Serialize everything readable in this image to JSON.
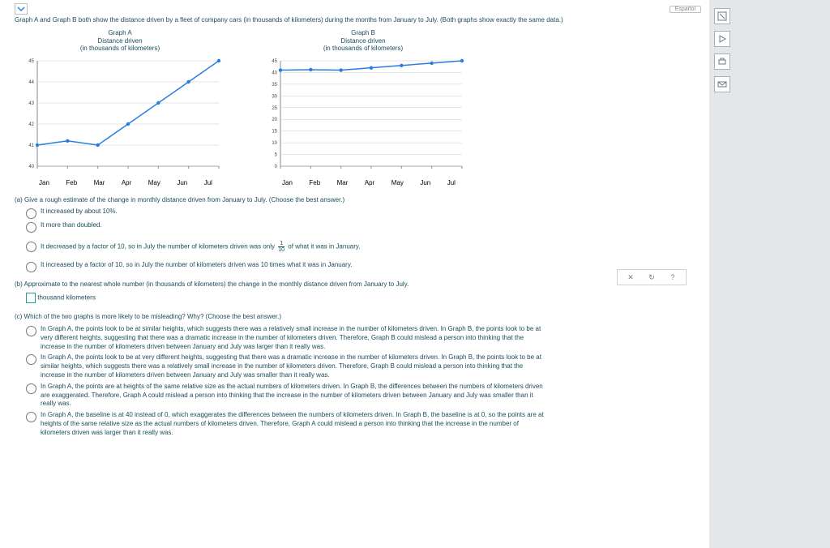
{
  "top": {
    "espanol": "Español"
  },
  "intro": "Graph A and Graph B both show the distance driven by a fleet of company cars (in thousands of kilometers) during the months from January to July. (Both graphs show exactly the same data.)",
  "graphA": {
    "title": "Graph A",
    "sub1": "Distance driven",
    "sub2": "(in thousands of kilometers)"
  },
  "graphB": {
    "title": "Graph B",
    "sub1": "Distance driven",
    "sub2": "(in thousands of kilometers)"
  },
  "months": [
    "Jan",
    "Feb",
    "Mar",
    "Apr",
    "May",
    "Jun",
    "Jul"
  ],
  "qa": {
    "prompt": "(a) Give a rough estimate of the change in monthly distance driven from January to July. (Choose the best answer.)",
    "o1": "It increased by about 10%.",
    "o2": "It more than doubled.",
    "o3a": "It decreased by a factor of 10, so in July the number of kilometers driven was only",
    "o3b": "of what it was in January.",
    "o4": "It increased by a factor of 10, so in July the number of kilometers driven was 10 times what it was in January."
  },
  "qb": {
    "prompt": "(b) Approximate to the nearest whole number (in thousands of kilometers) the change in the monthly distance driven from January to July.",
    "unit": "thousand kilometers"
  },
  "qc": {
    "prompt": "(c) Which of the two graphs is more likely to be misleading? Why? (Choose the best answer.)",
    "o1": "In Graph A, the points look to be at similar heights, which suggests there was a relatively small increase in the number of kilometers driven. In Graph B, the points look to be at very different heights, suggesting that there was a dramatic increase in the number of kilometers driven. Therefore, Graph B could mislead a person into thinking that the increase in the number of kilometers driven between January and July was larger than it really was.",
    "o2": "In Graph A, the points look to be at very different heights, suggesting that there was a dramatic increase in the number of kilometers driven. In Graph B, the points look to be at similar heights, which suggests there was a relatively small increase in the number of kilometers driven. Therefore, Graph B could mislead a person into thinking that the increase in the number of kilometers driven between January and July was smaller than it really was.",
    "o3": "In Graph A, the points are at heights of the same relative size as the actual numbers of kilometers driven. In Graph B, the differences between the numbers of kilometers driven are exaggerated. Therefore, Graph A could mislead a person into thinking that the increase in the number of kilometers driven between January and July was smaller than it really was.",
    "o4": "In Graph A, the baseline is at 40 instead of 0, which exaggerates the differences between the numbers of kilometers driven. In Graph B, the baseline is at 0, so the points are at heights of the same relative size as the actual numbers of kilometers driven. Therefore, Graph A could mislead a person into thinking that the increase in the number of kilometers driven was larger than it really was."
  },
  "frac": {
    "n": "1",
    "d": "10"
  },
  "chart_data": [
    {
      "type": "line",
      "title": "Graph A — Distance driven (in thousands of kilometers)",
      "categories": [
        "Jan",
        "Feb",
        "Mar",
        "Apr",
        "May",
        "Jun",
        "Jul"
      ],
      "values": [
        41.0,
        41.2,
        41.0,
        42.0,
        43.0,
        44.0,
        45.0
      ],
      "ylim": [
        40,
        45
      ],
      "xlabel": "",
      "ylabel": ""
    },
    {
      "type": "line",
      "title": "Graph B — Distance driven (in thousands of kilometers)",
      "categories": [
        "Jan",
        "Feb",
        "Mar",
        "Apr",
        "May",
        "Jun",
        "Jul"
      ],
      "values": [
        41.0,
        41.2,
        41.0,
        42.0,
        43.0,
        44.0,
        45.0
      ],
      "ylim": [
        0,
        45
      ],
      "xlabel": "",
      "ylabel": ""
    }
  ]
}
